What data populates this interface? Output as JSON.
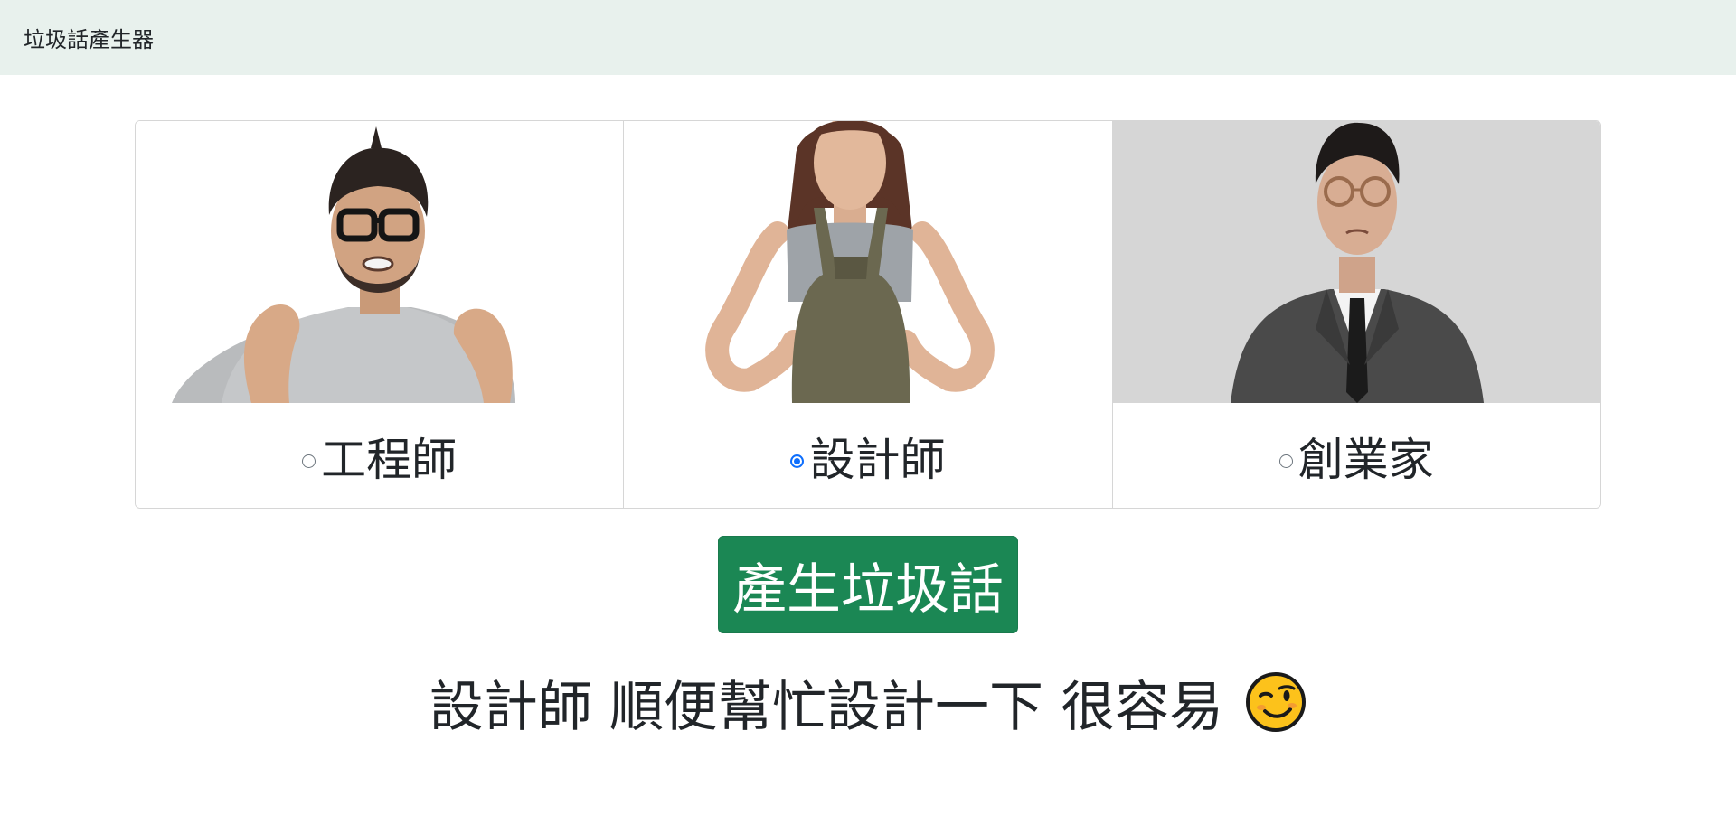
{
  "navbar": {
    "brand": "垃圾話產生器"
  },
  "roles": [
    {
      "label": "工程師",
      "value": "engineer",
      "checked": false,
      "image": "engineer-portrait"
    },
    {
      "label": "設計師",
      "value": "designer",
      "checked": true,
      "image": "designer-portrait"
    },
    {
      "label": "創業家",
      "value": "entrepreneur",
      "checked": false,
      "image": "entrepreneur-portrait"
    }
  ],
  "actions": {
    "generate_label": "產生垃圾話"
  },
  "result": {
    "text": "設計師 順便幫忙設計一下 很容易",
    "emoji": "winking-face-icon"
  },
  "colors": {
    "navbar_bg": "#e8f1ed",
    "button_bg": "#1b8754",
    "radio_checked": "#0d6efd"
  }
}
